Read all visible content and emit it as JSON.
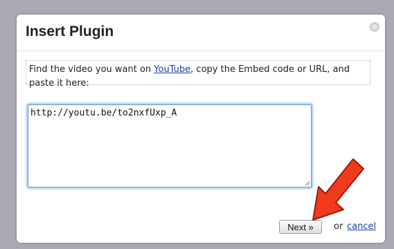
{
  "dialog": {
    "title": "Insert Plugin",
    "instructions": {
      "text_before": "Find the video you want on ",
      "link_label": "YouTube",
      "text_after": ", copy the Embed code or URL, and paste it here:"
    },
    "embed_input": {
      "value": "http://youtu.be/to2nxfUxp_A"
    },
    "next_label": "Next »",
    "or_label": "or",
    "cancel_label": "cancel"
  },
  "colors": {
    "backdrop": "#a9aab3",
    "link": "#1a3fa6",
    "focus_ring": "#9ec3ee",
    "annotation_arrow": "#f03a1e"
  },
  "icons": {
    "close": "close-icon",
    "resize": "resize-grip-icon",
    "annotation": "red-arrow-icon"
  }
}
